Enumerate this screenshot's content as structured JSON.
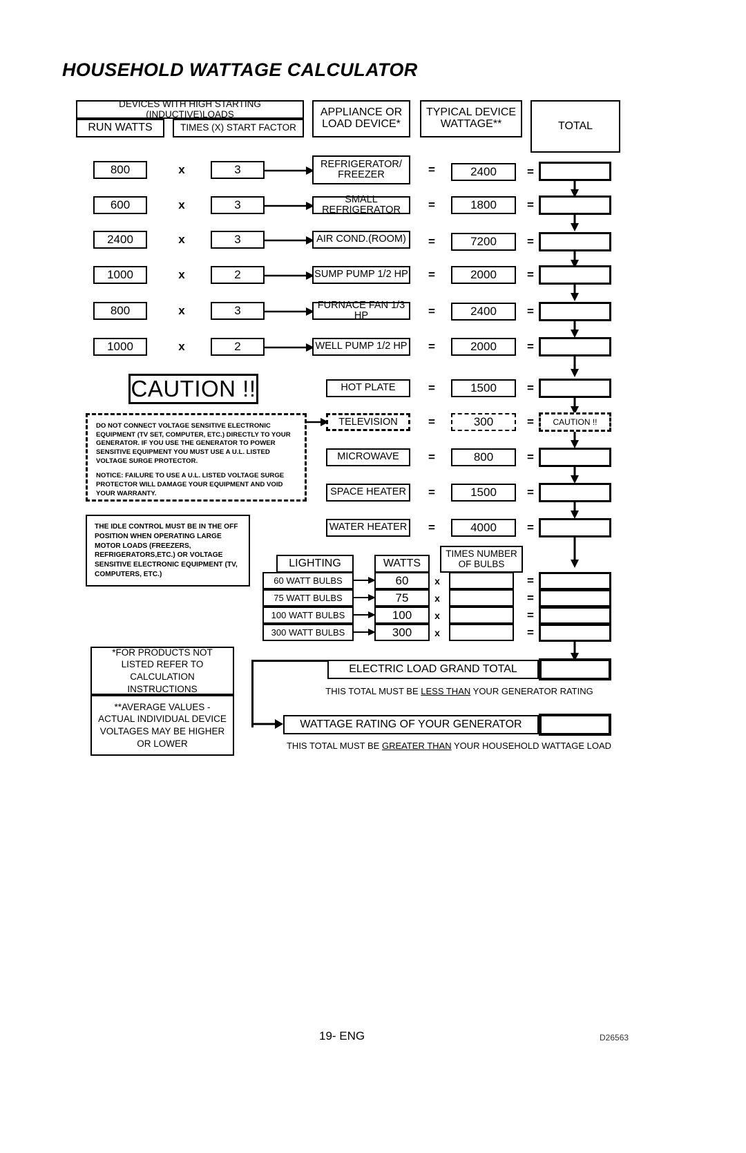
{
  "document": {
    "title": "HOUSEHOLD WATTAGE CALCULATOR",
    "footer_page": "19- ENG",
    "footer_code": "D26563"
  },
  "headers": {
    "inductive_group": "DEVICES WITH HIGH STARTING (INDUCTIVE)LOADS",
    "run_watts": "RUN WATTS",
    "start_factor": "TIMES (X) START FACTOR",
    "appliance": "APPLIANCE OR LOAD DEVICE*",
    "appliance_line1": "APPLIANCE OR",
    "appliance_line2": "LOAD DEVICE*",
    "typical_line1": "TYPICAL DEVICE",
    "typical_line2": "WATTAGE**",
    "total": "TOTAL"
  },
  "symbols": {
    "times": "x",
    "equals": "="
  },
  "inductive_rows": [
    {
      "run_watts": "800",
      "factor": "3",
      "device": "REFRIGERATOR/ FREEZER",
      "device_line1": "REFRIGERATOR/",
      "device_line2": "FREEZER",
      "wattage": "2400",
      "total": ""
    },
    {
      "run_watts": "600",
      "factor": "3",
      "device": "SMALL REFRIGERATOR",
      "wattage": "1800",
      "total": ""
    },
    {
      "run_watts": "2400",
      "factor": "3",
      "device": "AIR COND.(ROOM)",
      "wattage": "7200",
      "total": ""
    },
    {
      "run_watts": "1000",
      "factor": "2",
      "device": "SUMP PUMP 1/2 HP",
      "wattage": "2000",
      "total": ""
    },
    {
      "run_watts": "800",
      "factor": "3",
      "device": "FURNACE FAN 1/3 HP",
      "wattage": "2400",
      "total": ""
    },
    {
      "run_watts": "1000",
      "factor": "2",
      "device": "WELL PUMP 1/2 HP",
      "wattage": "2000",
      "total": ""
    }
  ],
  "resistive_rows": [
    {
      "device": "HOT PLATE",
      "wattage": "1500",
      "total": "",
      "dashed": false
    },
    {
      "device": "TELEVISION",
      "wattage": "300",
      "total": "CAUTION !!",
      "dashed": true
    },
    {
      "device": "MICROWAVE",
      "wattage": "800",
      "total": "",
      "dashed": false
    },
    {
      "device": "SPACE HEATER",
      "wattage": "1500",
      "total": "",
      "dashed": false
    },
    {
      "device": "WATER HEATER",
      "wattage": "4000",
      "total": "",
      "dashed": false
    }
  ],
  "caution": {
    "banner": "CAUTION !!",
    "paragraph1": "DO NOT CONNECT VOLTAGE SENSITIVE ELECTRONIC EQUIPMENT (TV SET, COMPUTER, ETC.) DIRECTLY TO YOUR GENERATOR. IF YOU USE THE GENERATOR TO POWER SENSITIVE EQUIPMENT YOU MUST USE A U.L. LISTED VOLTAGE SURGE PROTECTOR.",
    "paragraph2": "NOTICE:  FAILURE TO USE A U.L. LISTED VOLTAGE SURGE PROTECTOR WILL DAMAGE YOUR EQUIPMENT AND VOID YOUR WARRANTY."
  },
  "idle_control": {
    "text": "THE IDLE CONTROL MUST BE IN THE OFF POSITION WHEN OPERATING LARGE MOTOR LOADS (FREEZERS, REFRIGERATORS,ETC.) OR VOLTAGE SENSITIVE ELECTRONIC EQUIPMENT (TV, COMPUTERS, ETC.)"
  },
  "lighting": {
    "header_lighting": "LIGHTING",
    "header_watts": "WATTS",
    "header_bulbs_line1": "TIMES NUMBER",
    "header_bulbs_line2": "OF BULBS",
    "rows": [
      {
        "label": "60 WATT BULBS",
        "watts": "60",
        "count": "",
        "total": ""
      },
      {
        "label": "75 WATT BULBS",
        "watts": "75",
        "count": "",
        "total": ""
      },
      {
        "label": "100 WATT BULBS",
        "watts": "100",
        "count": "",
        "total": ""
      },
      {
        "label": "300 WATT BULBS",
        "watts": "300",
        "count": "",
        "total": ""
      }
    ]
  },
  "footnotes": {
    "asterisk": "*FOR PRODUCTS NOT LISTED REFER TO CALCULATION INSTRUCTIONS",
    "double_asterisk": "**AVERAGE VALUES - ACTUAL INDIVIDUAL DEVICE VOLTAGES MAY BE HIGHER OR LOWER"
  },
  "totals": {
    "grand_total_label": "ELECTRIC LOAD GRAND TOTAL",
    "grand_total_value": "",
    "grand_total_note_pre": "THIS TOTAL MUST BE ",
    "grand_total_note_em": "LESS THAN",
    "grand_total_note_post": " YOUR GENERATOR RATING",
    "generator_label": "WATTAGE RATING OF YOUR GENERATOR",
    "generator_value": "",
    "generator_note_pre": "THIS TOTAL MUST BE ",
    "generator_note_em": "GREATER THAN",
    "generator_note_post": " YOUR HOUSEHOLD WATTAGE LOAD"
  }
}
